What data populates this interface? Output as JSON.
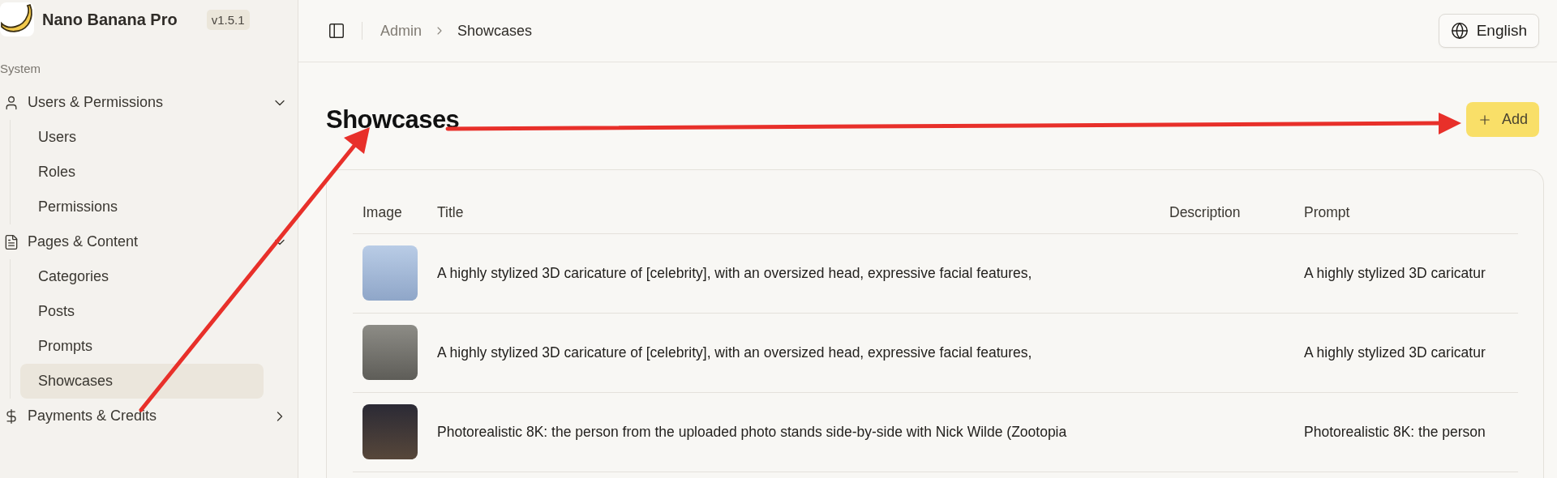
{
  "app": {
    "name": "Nano Banana Pro",
    "version": "v1.5.1"
  },
  "sidebar": {
    "section": "System",
    "groups": [
      {
        "label": "Users & Permissions",
        "expanded": true,
        "children": [
          {
            "label": "Users",
            "selected": false
          },
          {
            "label": "Roles",
            "selected": false
          },
          {
            "label": "Permissions",
            "selected": false
          }
        ]
      },
      {
        "label": "Pages & Content",
        "expanded": true,
        "children": [
          {
            "label": "Categories",
            "selected": false
          },
          {
            "label": "Posts",
            "selected": false
          },
          {
            "label": "Prompts",
            "selected": false
          },
          {
            "label": "Showcases",
            "selected": true
          }
        ]
      },
      {
        "label": "Payments & Credits",
        "expanded": false
      }
    ]
  },
  "header": {
    "breadcrumb": [
      "Admin",
      "Showcases"
    ],
    "language": "English"
  },
  "page": {
    "title": "Showcases",
    "add_button": "Add"
  },
  "table": {
    "columns": [
      "Image",
      "Title",
      "Description",
      "Prompt"
    ],
    "rows": [
      {
        "title": "A highly stylized 3D caricature of [celebrity], with an oversized head, expressive facial features,",
        "prompt": "A highly stylized 3D caricatur"
      },
      {
        "title": "A highly stylized 3D caricature of [celebrity], with an oversized head, expressive facial features,",
        "prompt": "A highly stylized 3D caricatur"
      },
      {
        "title": "Photorealistic 8K: the person from the uploaded photo stands side-by-side with Nick Wilde (Zootopia",
        "prompt": "Photorealistic 8K: the person"
      }
    ]
  }
}
